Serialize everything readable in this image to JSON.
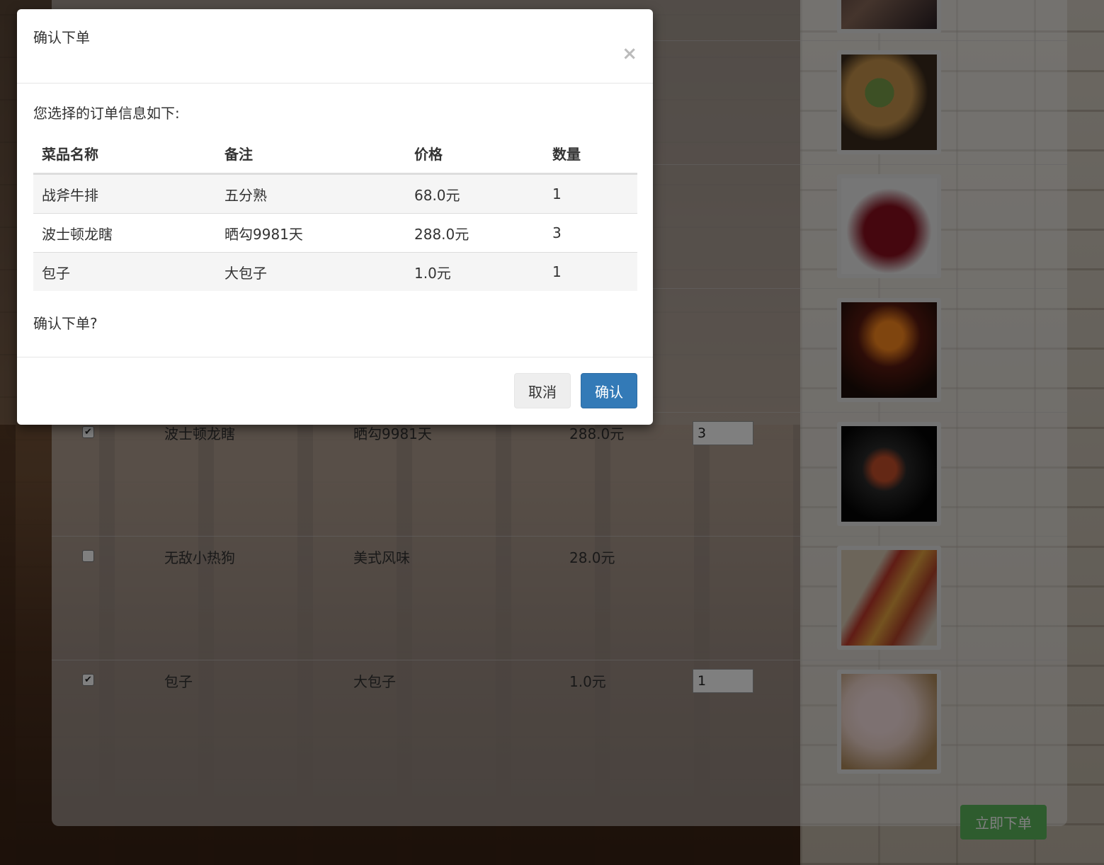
{
  "menu": {
    "rows": [
      {
        "checked": false,
        "name": "",
        "note": "",
        "price": "",
        "qty": "",
        "image": "burger-photo"
      },
      {
        "checked": false,
        "name": "",
        "note": "",
        "price": "",
        "qty": "",
        "image": "cherries-photo"
      },
      {
        "checked": false,
        "name": "",
        "note": "",
        "price": "",
        "qty": "",
        "image": "red-wine-photo"
      },
      {
        "checked": true,
        "name": "波士顿龙瞎",
        "note": "晒勾9981天",
        "price": "288.0元",
        "qty": "3",
        "image": "lobster-photo"
      },
      {
        "checked": false,
        "name": "无敌小热狗",
        "note": "美式风味",
        "price": "28.0元",
        "qty": "",
        "image": "hotdog-photo"
      },
      {
        "checked": true,
        "name": "包子",
        "note": "大包子",
        "price": "1.0元",
        "qty": "1",
        "image": "steamed-buns-photo"
      }
    ],
    "order_button": "立即下单"
  },
  "modal": {
    "title": "确认下单",
    "close_icon": "×",
    "intro": "您选择的订单信息如下:",
    "columns": [
      "菜品名称",
      "备注",
      "价格",
      "数量"
    ],
    "items": [
      {
        "name": "战斧牛排",
        "note": "五分熟",
        "price": "68.0元",
        "qty": "1"
      },
      {
        "name": "波士顿龙瞎",
        "note": "晒勾9981天",
        "price": "288.0元",
        "qty": "3"
      },
      {
        "name": "包子",
        "note": "大包子",
        "price": "1.0元",
        "qty": "1"
      }
    ],
    "confirm_question": "确认下单?",
    "cancel_label": "取消",
    "ok_label": "确认"
  }
}
